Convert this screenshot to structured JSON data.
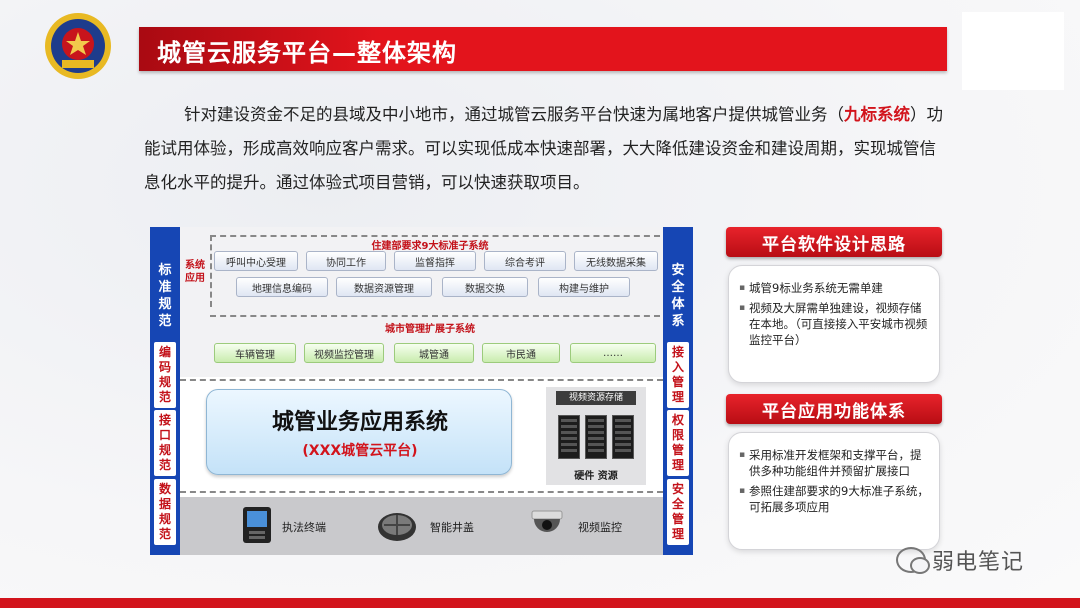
{
  "header": {
    "title": "城管云服务平台—整体架构"
  },
  "intro": {
    "part1": "针对建设资金不足的县域及中小地市，通过城管云服务平台快速为属地客户提供城管业务（",
    "highlight": "九标系统",
    "part2": "）功能试用体验，形成高效响应客户需求。可以实现低成本快速部署，大大降低建设资金和建设周期，实现城管信息化水平的提升。通过体验式项目营销，可以快速获取项目。"
  },
  "diagram": {
    "left_labels": [
      "标准规范",
      "编码规范",
      "接口规范",
      "数据规范"
    ],
    "right_labels": [
      "安全体系",
      "接入管理",
      "权限管理",
      "安全管理"
    ],
    "system_label": "系统应用",
    "standard_title": "住建部要求9大标准子系统",
    "standard_row1": [
      "呼叫中心受理",
      "协同工作",
      "监督指挥",
      "综合考评",
      "无线数据采集"
    ],
    "standard_row2": [
      "地理信息编码",
      "数据资源管理",
      "数据交换",
      "构建与维护"
    ],
    "extension_title": "城市管理扩展子系统",
    "extension_items": [
      "车辆管理",
      "视频监控管理",
      "城管通",
      "市民通",
      "……"
    ],
    "main_title": "城管业务应用系统",
    "main_subtitle": "(XXX城管云平台)",
    "storage_title": "视频资源存储",
    "storage_caption": "硬件 资源",
    "devices": [
      "执法终端",
      "智能井盖",
      "视频监控"
    ]
  },
  "panel_design": {
    "title": "平台软件设计思路",
    "items": [
      "城管9标业务系统无需单建",
      "视频及大屏需单独建设，视频存储在本地。（可直接接入平安城市视频监控平台）"
    ]
  },
  "panel_function": {
    "title": "平台应用功能体系",
    "items": [
      "采用标准开发框架和支撑平台，提供多种功能组件并预留扩展接口",
      "参照住建部要求的9大标准子系统，可拓展多项应用"
    ]
  },
  "watermark": {
    "text": "弱电笔记",
    "icon": "wechat-icon"
  },
  "colors": {
    "accent_red": "#e3141c",
    "diagram_blue": "#1646b4"
  }
}
